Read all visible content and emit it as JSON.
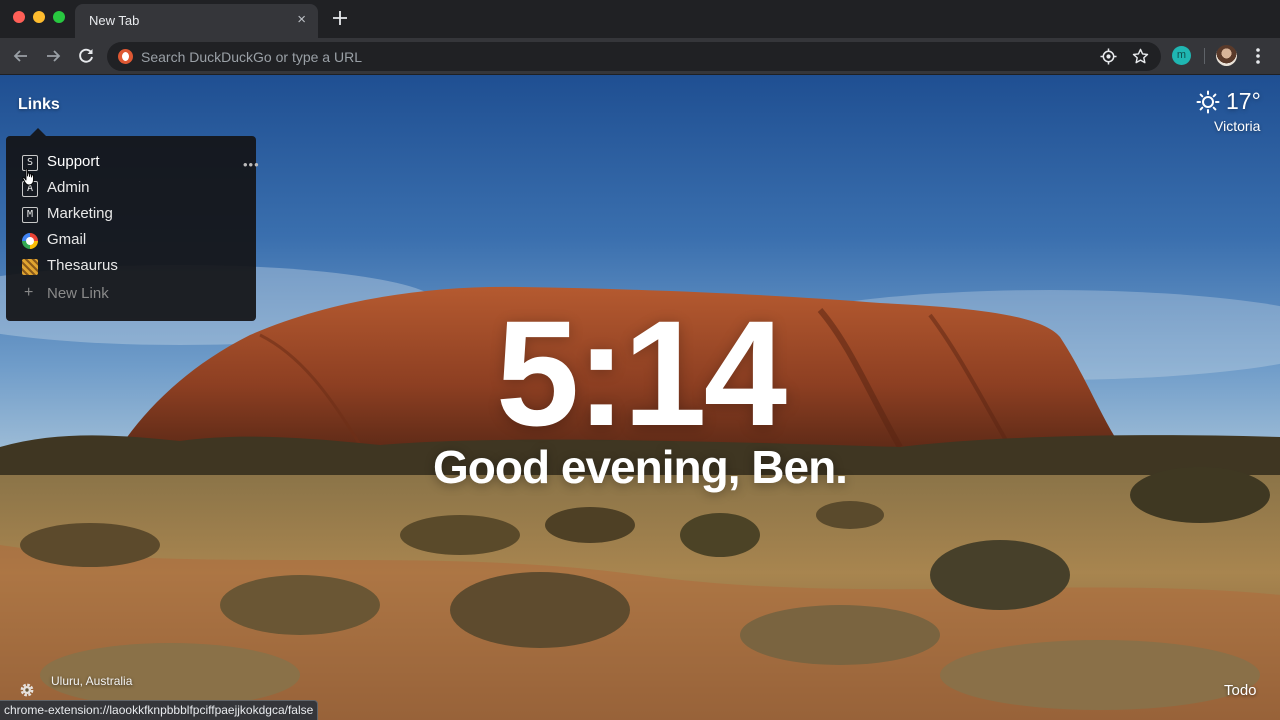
{
  "browser": {
    "tab_title": "New Tab",
    "tab_close": "×",
    "omnibox_placeholder": "Search DuckDuckGo or type a URL",
    "extension_letter": "m",
    "status_url": "chrome-extension://laookkfknpbbblfpciffpaejjkokdgca/false"
  },
  "links": {
    "title": "Links",
    "items": [
      {
        "label": "Support",
        "icon": "S",
        "icon_name": "letter-s-icon"
      },
      {
        "label": "Admin",
        "icon": "A",
        "icon_name": "letter-a-icon"
      },
      {
        "label": "Marketing",
        "icon": "M",
        "icon_name": "letter-m-icon"
      },
      {
        "label": "Gmail",
        "icon": "",
        "icon_name": "google-icon"
      },
      {
        "label": "Thesaurus",
        "icon": "",
        "icon_name": "thesaurus-icon"
      }
    ],
    "more": "•••",
    "new_link": "New Link",
    "new_link_plus": "+"
  },
  "weather": {
    "temperature": "17°",
    "location": "Victoria",
    "icon": "sun-icon"
  },
  "clock": {
    "time": "5:14",
    "greeting": "Good evening, Ben."
  },
  "footer": {
    "photo_location": "Uluru, Australia",
    "todo": "Todo"
  },
  "colors": {
    "accent_ddg": "#de5833",
    "extension": "#1fb6b2",
    "toolbar": "#35363a",
    "frame": "#202124"
  }
}
